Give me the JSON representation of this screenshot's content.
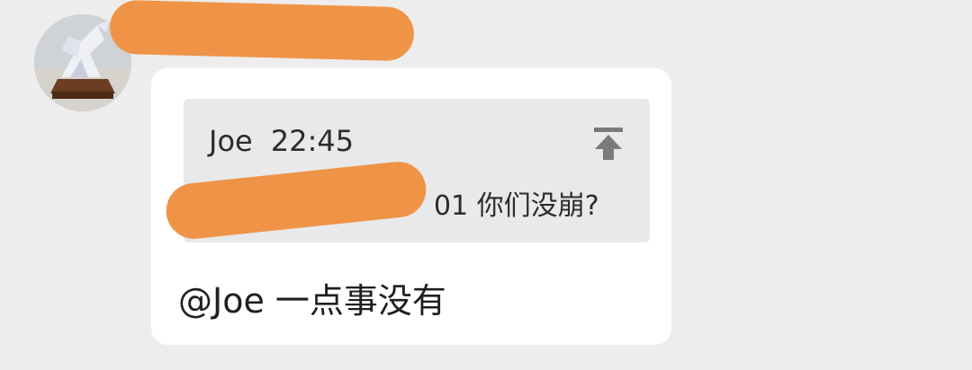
{
  "sender": {
    "avatar_icon": "avatar-image"
  },
  "message": {
    "quote": {
      "author": "Joe",
      "time": "22:45",
      "visible_text": "01 你们没崩?",
      "pin_icon": "pin-to-top-icon"
    },
    "reply": "@Joe 一点事没有"
  },
  "colors": {
    "page_bg": "#ededed",
    "bubble_bg": "#ffffff",
    "quote_bg": "#e8e9ea",
    "redaction": "#ef9447",
    "icon": "#7a7a7a"
  }
}
